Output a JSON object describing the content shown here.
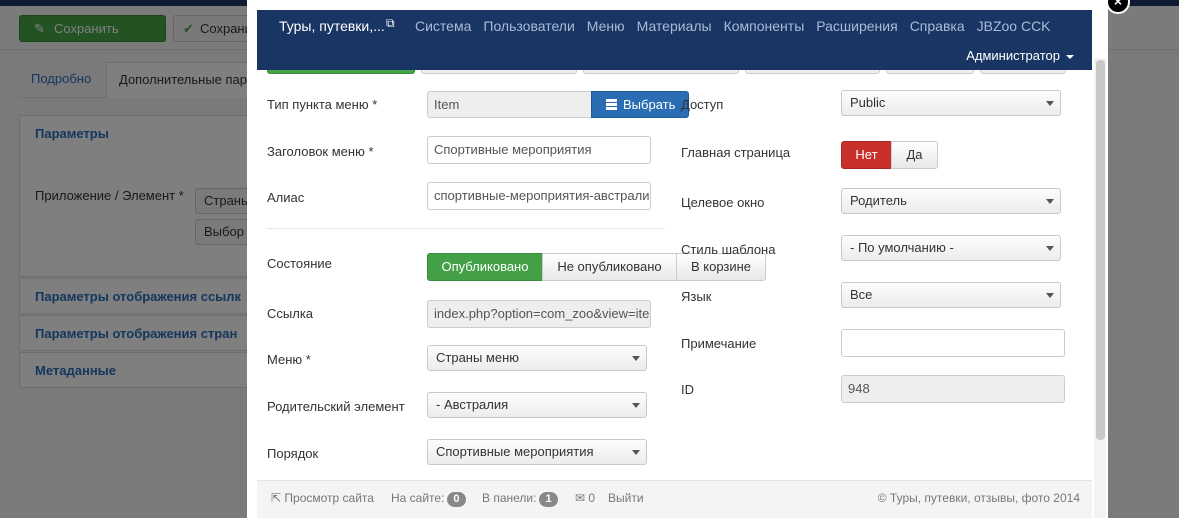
{
  "background": {
    "toolbar": {
      "save_label": "Сохранить",
      "save2_label": "Сохрани"
    },
    "tabs": [
      "Подробно",
      "Дополнительные пара"
    ],
    "panels": [
      "Параметры",
      "Параметры отображения ссылк",
      "Параметры отображения стран",
      "Метаданные"
    ],
    "app_element_label": "Приложение / Элемент *",
    "select1": "Страны",
    "select2": "Выбор с"
  },
  "navbar": {
    "site": "Туры, путевки,...",
    "menu": [
      "Система",
      "Пользователи",
      "Меню",
      "Материалы",
      "Компоненты",
      "Расширения",
      "Справка",
      "JBZoo CCK"
    ],
    "user": "Администратор"
  },
  "form": {
    "menu_item_type": {
      "label": "Тип пункта меню *",
      "value": "Item",
      "button": "Выбрать"
    },
    "menu_title": {
      "label": "Заголовок меню *",
      "value": "Спортивные мероприятия"
    },
    "alias": {
      "label": "Алиас",
      "value": "спортивные-мероприятия-австрали"
    },
    "status": {
      "label": "Состояние",
      "options": [
        "Опубликовано",
        "Не опубликовано",
        "В корзине"
      ],
      "selected": "Опубликовано"
    },
    "link": {
      "label": "Ссылка",
      "value": "index.php?option=com_zoo&view=ite"
    },
    "menu": {
      "label": "Меню *",
      "value": "Страны меню"
    },
    "parent": {
      "label": "Родительский элемент",
      "value": "- Австралия"
    },
    "order": {
      "label": "Порядок",
      "value": "Спортивные мероприятия"
    },
    "access": {
      "label": "Доступ",
      "value": "Public"
    },
    "home": {
      "label": "Главная страница",
      "options": [
        "Нет",
        "Да"
      ],
      "selected": "Нет"
    },
    "target": {
      "label": "Целевое окно",
      "value": "Родитель"
    },
    "template_style": {
      "label": "Стиль шаблона",
      "value": "- По умолчанию -"
    },
    "language": {
      "label": "Язык",
      "value": "Все"
    },
    "note": {
      "label": "Примечание",
      "value": ""
    },
    "id": {
      "label": "ID",
      "value": "948"
    }
  },
  "footer": {
    "preview": "Просмотр сайта",
    "on_site_label": "На сайте:",
    "on_site_count": "0",
    "in_panel_label": "В панели:",
    "in_panel_count": "1",
    "messages_count": "0",
    "logout": "Выйти",
    "copyright": "© Туры, путевки, отзывы, фото 2014"
  },
  "colors": {
    "navbar": "#193564",
    "published": "#43a047",
    "no": "#c8302c",
    "choose": "#2a6db3"
  }
}
